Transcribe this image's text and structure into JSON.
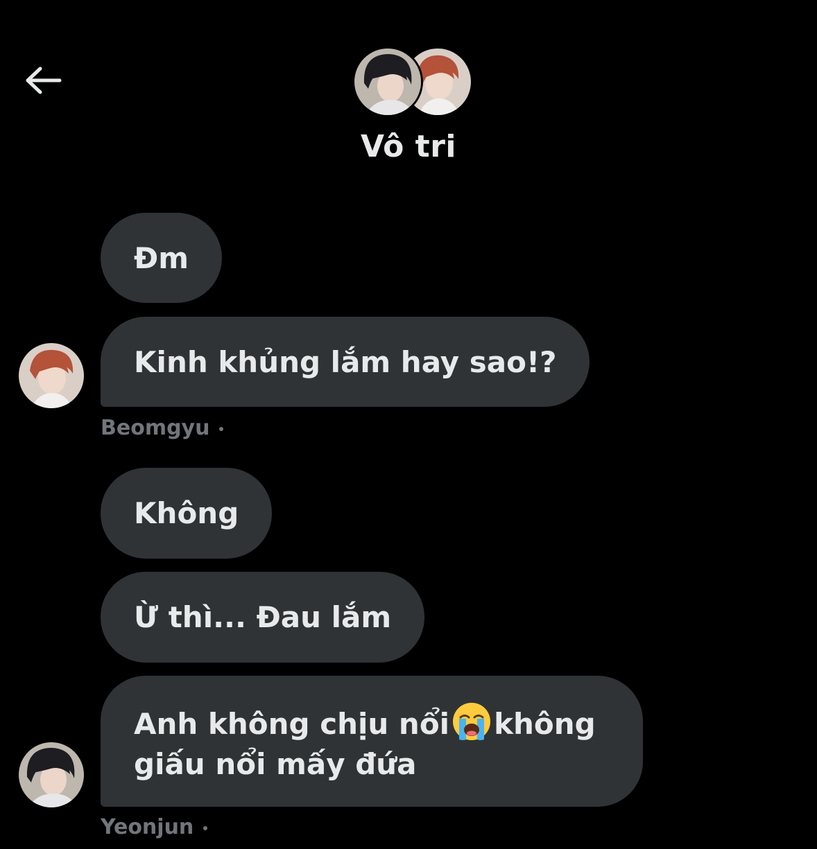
{
  "header": {
    "back_icon": "arrow-left-icon",
    "group_name": "Vô tri",
    "avatar_icons": [
      "person-avatar",
      "person-avatar"
    ]
  },
  "messages": [
    {
      "text": "Đm"
    },
    {
      "text": "Kinh khủng lắm hay sao!?"
    },
    {
      "text": "Không"
    },
    {
      "text": "Ừ thì... Đau lắm"
    },
    {
      "text_before_emoji": "Anh không chịu nổi",
      "emoji": "loudly-crying-face-icon",
      "text_after_emoji": "không giấu nổi mấy đứa"
    }
  ],
  "senders": {
    "first": "Beomgyu",
    "second": "Yeonjun"
  },
  "colors": {
    "background": "#000000",
    "bubble": "#2f3336",
    "text": "#e7e9ea",
    "muted": "#71767b"
  }
}
